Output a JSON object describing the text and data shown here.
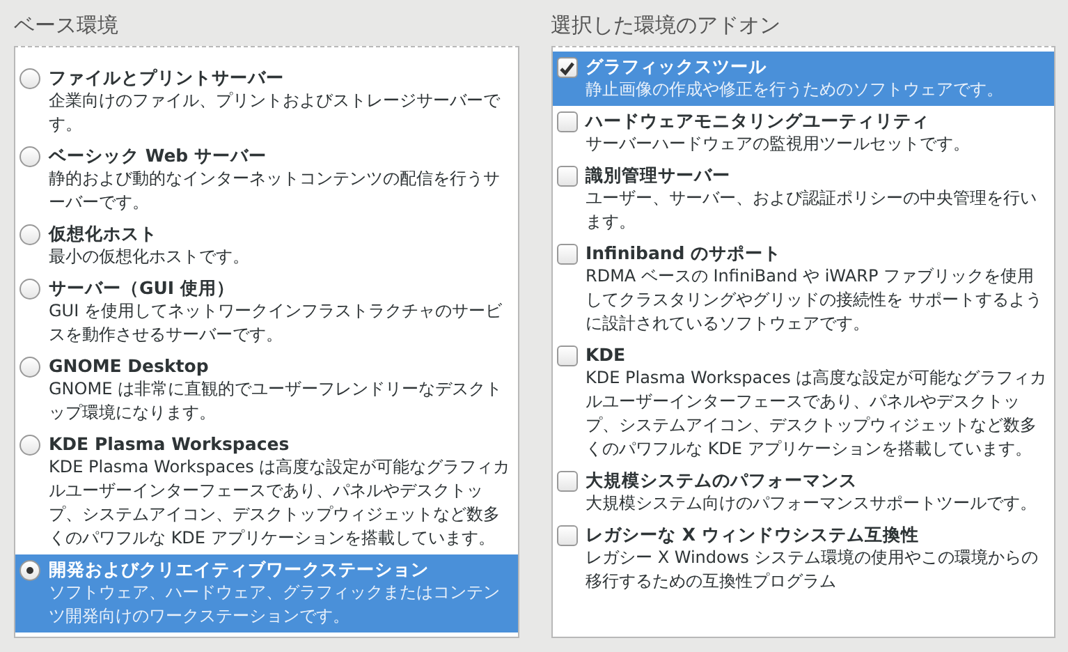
{
  "base_environment": {
    "title": "ベース環境",
    "items": [
      {
        "name": "ファイルとプリントサーバー",
        "description": "企業向けのファイル、プリントおよびストレージサーバーです。",
        "selected": false
      },
      {
        "name": "ベーシック Web サーバー",
        "description": "静的および動的なインターネットコンテンツの配信を行うサーバーです。",
        "selected": false
      },
      {
        "name": "仮想化ホスト",
        "description": "最小の仮想化ホストです。",
        "selected": false
      },
      {
        "name": "サーバー（GUI 使用）",
        "description": "GUI を使用してネットワークインフラストラクチャのサービスを動作させるサーバーです。",
        "selected": false
      },
      {
        "name": "GNOME Desktop",
        "description": "GNOME は非常に直観的でユーザーフレンドリーなデスクトップ環境になります。",
        "selected": false
      },
      {
        "name": "KDE Plasma Workspaces",
        "description": "KDE Plasma Workspaces は高度な設定が可能なグラフィカルユーザーインターフェースであり、パネルやデスクトップ、システムアイコン、デスクトップウィジェットなど数多くのパワフルな KDE アプリケーションを搭載しています。",
        "selected": false
      },
      {
        "name": "開発およびクリエイティブワークステーション",
        "description": "ソフトウェア、ハードウェア、グラフィックまたはコンテンツ開発向けのワークステーションです。",
        "selected": true
      }
    ]
  },
  "addons": {
    "title": "選択した環境のアドオン",
    "items": [
      {
        "name": "グラフィックスツール",
        "description": "静止画像の作成や修正を行うためのソフトウェアです。",
        "checked": true,
        "selected": true
      },
      {
        "name": "ハードウェアモニタリングユーティリティ",
        "description": "サーバーハードウェアの監視用ツールセットです。",
        "checked": false,
        "selected": false
      },
      {
        "name": "識別管理サーバー",
        "description": "ユーザー、サーバー、および認証ポリシーの中央管理を行います。",
        "checked": false,
        "selected": false
      },
      {
        "name": "Infiniband のサポート",
        "description": "RDMA ベースの InfiniBand や iWARP ファブリックを使用してクラスタリングやグリッドの接続性を サポートするように設計されているソフトウェアです。",
        "checked": false,
        "selected": false
      },
      {
        "name": "KDE",
        "description": "KDE Plasma Workspaces は高度な設定が可能なグラフィカルユーザーインターフェースであり、パネルやデスクトップ、システムアイコン、デスクトップウィジェットなど数多くのパワフルな KDE アプリケーションを搭載しています。",
        "checked": false,
        "selected": false
      },
      {
        "name": "大規模システムのパフォーマンス",
        "description": "大規模システム向けのパフォーマンスサポートツールです。",
        "checked": false,
        "selected": false
      },
      {
        "name": "レガシーな X ウィンドウシステム互換性",
        "description": "レガシー X Windows システム環境の使用やこの環境からの移行するための互換性プログラム",
        "checked": false,
        "selected": false
      }
    ]
  }
}
